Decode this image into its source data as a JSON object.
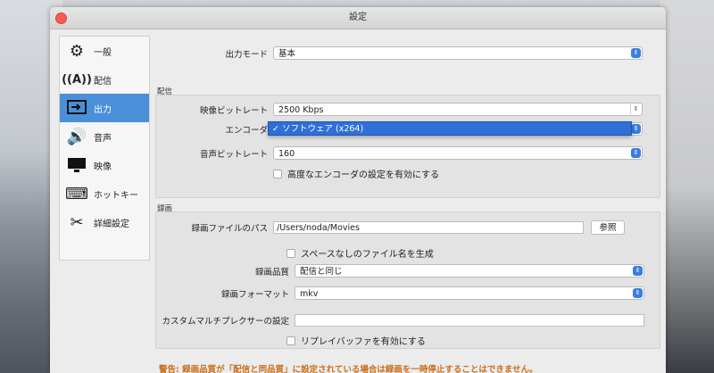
{
  "window": {
    "title": "設定"
  },
  "sidebar": {
    "items": [
      {
        "label": "一般",
        "icon": "gear-icon"
      },
      {
        "label": "配信",
        "icon": "broadcast-icon"
      },
      {
        "label": "出力",
        "icon": "output-icon"
      },
      {
        "label": "音声",
        "icon": "speaker-icon"
      },
      {
        "label": "映像",
        "icon": "monitor-icon"
      },
      {
        "label": "ホットキー",
        "icon": "keyboard-icon"
      },
      {
        "label": "詳細設定",
        "icon": "tools-icon"
      }
    ],
    "active": "出力"
  },
  "output_mode": {
    "label": "出力モード",
    "value": "基本"
  },
  "streaming": {
    "section_title": "配信",
    "video_bitrate": {
      "label": "映像ビットレート",
      "value": "2500 Kbps"
    },
    "encoder": {
      "label": "エンコーダ",
      "value": "✓ ソフトウェア (x264)"
    },
    "audio_bitrate": {
      "label": "音声ビットレート",
      "value": "160"
    },
    "advanced_checkbox": {
      "label": "高度なエンコーダの設定を有効にする",
      "checked": false
    }
  },
  "recording": {
    "section_title": "録画",
    "path": {
      "label": "録画ファイルのパス",
      "value": "/Users/noda/Movies",
      "browse": "参照"
    },
    "no_space_checkbox": {
      "label": "スペースなしのファイル名を生成",
      "checked": false
    },
    "quality": {
      "label": "録画品質",
      "value": "配信と同じ"
    },
    "format": {
      "label": "録画フォーマット",
      "value": "mkv"
    },
    "muxer": {
      "label": "カスタムマルチプレクサーの設定",
      "value": ""
    },
    "replay_checkbox": {
      "label": "リプレイバッファを有効にする",
      "checked": false
    }
  },
  "warning": "警告: 録画品質が「配信と同品質」に設定されている場合は録画を一時停止することはできません。"
}
